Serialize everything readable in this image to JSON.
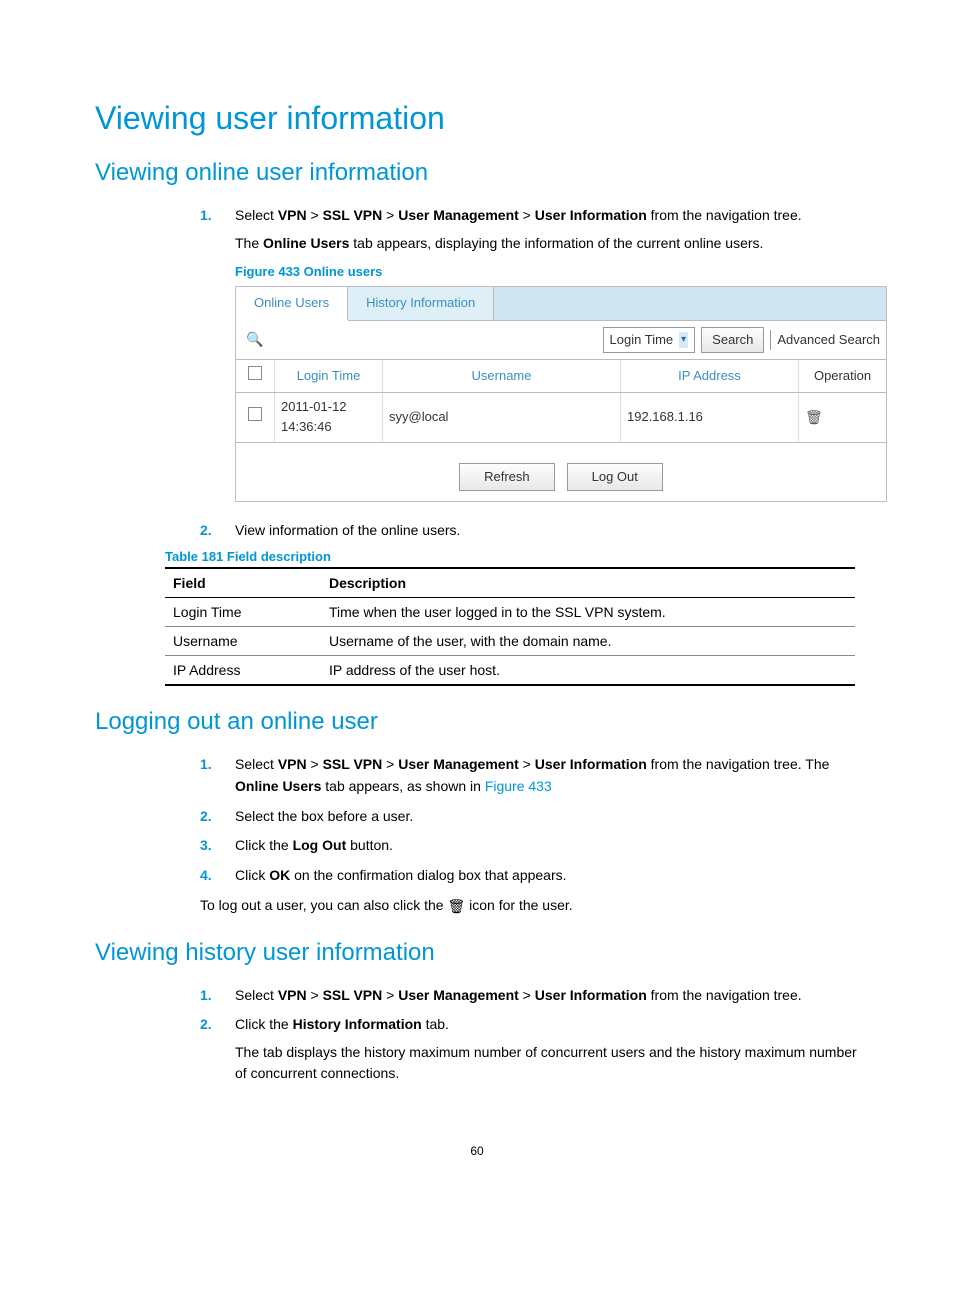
{
  "headings": {
    "h1": "Viewing user information",
    "h2a": "Viewing online user information",
    "h2b": "Logging out an online user",
    "h2c": "Viewing history user information"
  },
  "sectionA": {
    "steps": [
      {
        "n": "1.",
        "pre": "Select ",
        "b1": "VPN",
        "sep": " > ",
        "b2": "SSL VPN",
        "b3": "User Management",
        "b4": "User Information",
        "post": " from the navigation tree."
      },
      {
        "n": "2.",
        "text": "View information of the online users."
      }
    ],
    "onlineUsersLine_pre": "The ",
    "onlineUsersLine_b": "Online Users",
    "onlineUsersLine_post": " tab appears, displaying the information of the current online users.",
    "figCaption": "Figure 433 Online users",
    "tableCaption": "Table 181 Field description"
  },
  "figure": {
    "tabs": {
      "active": "Online Users",
      "inactive": "History Information"
    },
    "dropdown": "Login Time",
    "searchBtn": "Search",
    "advSearch": "Advanced Search",
    "cols": {
      "login": "Login Time",
      "user": "Username",
      "ip": "IP Address",
      "op": "Operation"
    },
    "row": {
      "login": "2011-01-12 14:36:46",
      "user": "syy@local",
      "ip": "192.168.1.16"
    },
    "refresh": "Refresh",
    "logout": "Log Out"
  },
  "descTable": {
    "headers": {
      "field": "Field",
      "desc": "Description"
    },
    "rows": [
      {
        "field": "Login Time",
        "desc": "Time when the user logged in to the SSL VPN system."
      },
      {
        "field": "Username",
        "desc": "Username of the user, with the domain name."
      },
      {
        "field": "IP Address",
        "desc": "IP address of the user host."
      }
    ]
  },
  "sectionB": {
    "steps": [
      {
        "n": "1."
      },
      {
        "n": "2.",
        "text": "Select the box before a user."
      },
      {
        "n": "3.",
        "pre": "Click the ",
        "b": "Log Out",
        "post": " button."
      },
      {
        "n": "4.",
        "pre": "Click ",
        "b": "OK",
        "post": " on the confirmation dialog box that appears."
      }
    ],
    "step1_pre": "Select ",
    "step1_b1": "VPN",
    "step1_sep": " > ",
    "step1_b2": "SSL VPN",
    "step1_b3": "User Management",
    "step1_b4": "User Information",
    "step1_mid": " from the navigation tree. The ",
    "step1_b5": "Online Users",
    "step1_mid2": " tab appears, as shown in ",
    "step1_link": "Figure 433",
    "trailing": "To log out a user, you can also click the ",
    "trailing2": " icon for the user."
  },
  "sectionC": {
    "steps": [
      {
        "n": "1.",
        "pre": "Select ",
        "b1": "VPN",
        "sep": " > ",
        "b2": "SSL VPN",
        "b3": "User Management",
        "b4": "User Information",
        "post": " from the navigation tree."
      },
      {
        "n": "2.",
        "pre": "Click the ",
        "b": "History Information",
        "post": " tab."
      }
    ],
    "follow": "The tab displays the history maximum number of concurrent users and the history maximum number of concurrent connections."
  },
  "pageNumber": "60"
}
